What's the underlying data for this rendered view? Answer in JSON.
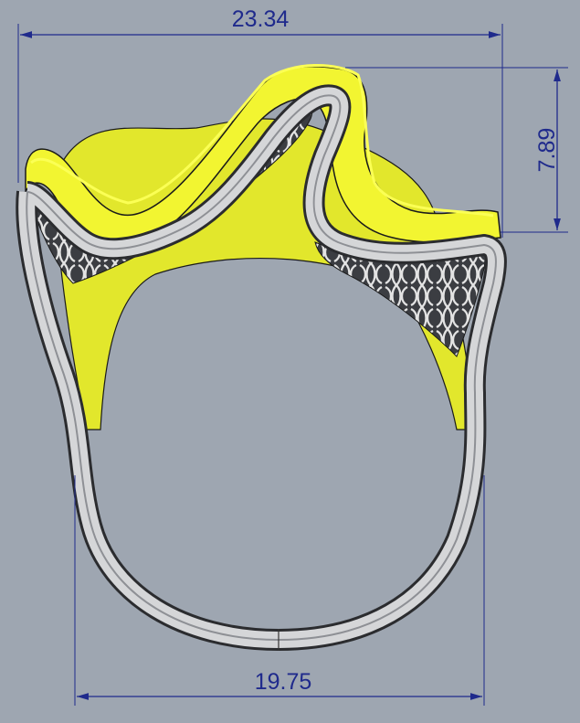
{
  "dimensions": {
    "top_width": "23.34",
    "right_height": "7.89",
    "bottom_width": "19.75"
  },
  "colors": {
    "background": "#9ea6b1",
    "dimension_line": "#1f2a8c",
    "yellow_surface": "#e6ea2e",
    "yellow_highlight": "#f7ff3a",
    "metal_light": "#d7d8d9",
    "metal_dark": "#5d6065",
    "outline": "#1a1a1a"
  }
}
